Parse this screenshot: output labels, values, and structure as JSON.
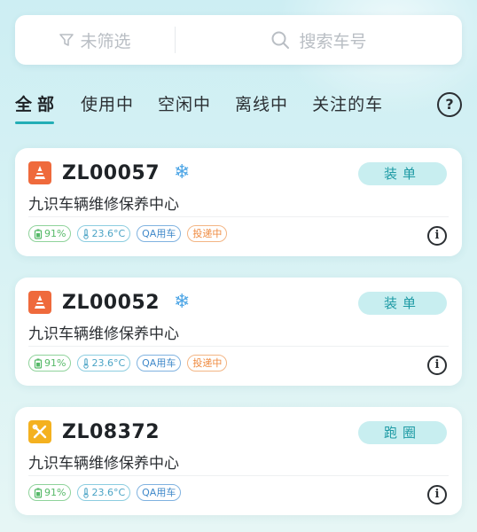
{
  "colors": {
    "accent": "#22aeb6",
    "bg": "#d3f0f4",
    "orange": "#ef6a3c",
    "yellow": "#f4b11f"
  },
  "filter": {
    "label": "未筛选",
    "icon": "filter-icon"
  },
  "search": {
    "placeholder": "搜索车号",
    "icon": "search-icon"
  },
  "tabs": [
    {
      "label": "全部",
      "active": true
    },
    {
      "label": "使用中"
    },
    {
      "label": "空闲中"
    },
    {
      "label": "离线中"
    },
    {
      "label": "关注的车"
    }
  ],
  "help_label": "?",
  "vehicles": [
    {
      "plate": "ZL00057",
      "type_icon": "traffic-cone-icon",
      "cold_chain": "snowflake-icon",
      "action": "装单",
      "station": "九识车辆维修保养中心",
      "tags": {
        "battery": "91%",
        "temp": "23.6°C",
        "qa": "QA用车",
        "delivery": "投递中"
      },
      "info": "i"
    },
    {
      "plate": "ZL00052",
      "type_icon": "traffic-cone-icon",
      "cold_chain": "snowflake-icon",
      "action": "装单",
      "station": "九识车辆维修保养中心",
      "tags": {
        "battery": "91%",
        "temp": "23.6°C",
        "qa": "QA用车",
        "delivery": "投递中"
      },
      "info": "i"
    },
    {
      "plate": "ZL08372",
      "type_icon": "wrench-screwdriver-icon",
      "action": "跑圈",
      "station": "九识车辆维修保养中心",
      "tags": {
        "battery": "91%",
        "temp": "23.6°C",
        "qa": "QA用车"
      },
      "info": "i"
    }
  ]
}
